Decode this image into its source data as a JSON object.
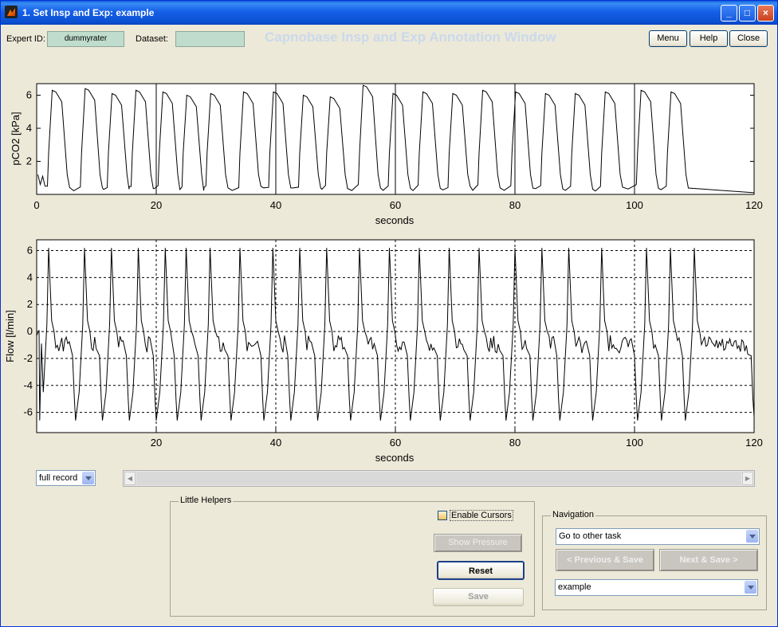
{
  "window": {
    "title": "1. Set Insp and Exp: example",
    "min": "_",
    "max": "□",
    "close": "×"
  },
  "header": {
    "expert_label": "Expert ID:",
    "expert_value": "dummyrater",
    "dataset_label": "Dataset:",
    "dataset_value": "",
    "ghost_title": "Capnobase Insp and Exp Annotation Window",
    "menu_btn": "Menu",
    "help_btn": "Help",
    "close_btn": "Close"
  },
  "plot1": {
    "ylabel": "pCO2 [kPa]",
    "xlabel": "seconds",
    "xticks": [
      "0",
      "20",
      "40",
      "60",
      "80",
      "100",
      "120"
    ],
    "yticks": [
      "2",
      "4",
      "6"
    ]
  },
  "plot2": {
    "ylabel": "Flow  [l/min]",
    "xlabel": "seconds",
    "xticks": [
      "20",
      "40",
      "60",
      "80",
      "100",
      "120"
    ],
    "yticks": [
      "6",
      "4",
      "2",
      "0",
      "-2",
      "-4",
      "-6"
    ]
  },
  "chart_data": [
    {
      "type": "line",
      "ylabel": "pCO2 [kPa]",
      "xlabel": "seconds",
      "xlim": [
        0,
        120
      ],
      "ylim": [
        0,
        6.7
      ],
      "grid": "x-only",
      "peaks_x": [
        3,
        8.5,
        13,
        17,
        21.5,
        25.5,
        29.5,
        35,
        40,
        45,
        49.5,
        55,
        60,
        65,
        70,
        75,
        80.5,
        85.5,
        90.5,
        95.5,
        101.5,
        106.5
      ],
      "peak_values": [
        6.3,
        6.4,
        6.1,
        6.3,
        6.2,
        6.0,
        6.1,
        6.2,
        6.2,
        6.0,
        5.9,
        6.6,
        6.1,
        6.2,
        6.1,
        6.3,
        6.2,
        6.1,
        6.1,
        6.2,
        6.3,
        6.2
      ],
      "baseline": 0.2
    },
    {
      "type": "line",
      "ylabel": "Flow  [l/min]",
      "xlabel": "seconds",
      "xlim": [
        0,
        120
      ],
      "ylim": [
        -7.5,
        6.8
      ],
      "grid": "dashed",
      "insp_peaks_x": [
        2,
        8,
        12.5,
        17,
        21.5,
        25,
        29,
        34,
        39.5,
        44,
        48.5,
        54,
        59,
        64,
        69,
        74,
        80,
        84.5,
        89,
        94.5,
        102,
        106,
        110
      ]
    }
  ],
  "range_select": {
    "value": "full record"
  },
  "helpers": {
    "title": "Little Helpers",
    "enable_cursors": "Enable Cursors",
    "show_pressure": "Show Pressure",
    "reset": "Reset",
    "save": "Save"
  },
  "navigation": {
    "title": "Navigation",
    "task_select": "Go to other task",
    "prev_btn": "< Previous & Save",
    "next_btn": "Next & Save >",
    "dataset_select": "example"
  }
}
